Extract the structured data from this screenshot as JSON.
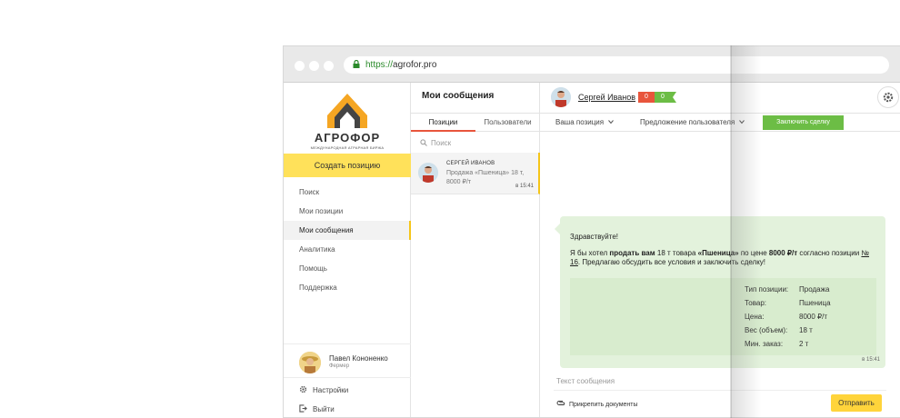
{
  "browser": {
    "url_protocol": "https://",
    "url_host": "agrofor.pro"
  },
  "sidebar": {
    "logo_name": "АГРОФОР",
    "logo_sub": "МЕЖДУНАРОДНАЯ АГРАРНАЯ БИРЖА",
    "create_button": "Создать позицию",
    "nav": [
      {
        "label": "Поиск"
      },
      {
        "label": "Мои позиции"
      },
      {
        "label": "Мои сообщения"
      },
      {
        "label": "Аналитика"
      },
      {
        "label": "Помощь"
      },
      {
        "label": "Поддержка"
      }
    ],
    "active_index": 2,
    "user": {
      "name": "Павел Кононенко",
      "role": "Фермер"
    },
    "settings_label": "Настройки",
    "logout_label": "Выйти"
  },
  "messages": {
    "title": "Мои сообщения",
    "tabs": [
      {
        "label": "Позиции"
      },
      {
        "label": "Пользователи"
      }
    ],
    "search_placeholder": "Поиск",
    "conversations": [
      {
        "name": "СЕРГЕЙ ИВАНОВ",
        "preview": "Продажа «Пшеница» 18 т, 8000 ₽/т",
        "time": "в 15:41"
      }
    ]
  },
  "chat": {
    "user_name": "Сергей Иванов",
    "score_negative": "0",
    "score_positive": "0",
    "dropdown_position": "Ваша позиция",
    "dropdown_offer": "Предложение пользователя",
    "deal_button": "Заключить сделку",
    "message": {
      "greeting": "Здравствуйте!",
      "text_1": "Я бы хотел ",
      "text_bold_1": "продать вам",
      "text_2": " 18 т товара ",
      "text_bold_2": "«Пшеница»",
      "text_3": " по цене ",
      "text_bold_3": "8000 ₽/т",
      "text_4": " согласно позиции ",
      "link": "№ 16",
      "text_5": ". Предлагаю обсудить все условия и заключить сделку!",
      "details": [
        {
          "key": "Тип позиции:",
          "value": "Продажа"
        },
        {
          "key": "Товар:",
          "value": "Пшеница"
        },
        {
          "key": "Цена:",
          "value": "8000 ₽/т"
        },
        {
          "key": "Вес (объем):",
          "value": "18 т"
        },
        {
          "key": "Мин. заказ:",
          "value": "2 т"
        }
      ],
      "time": "в 15:41"
    },
    "composer_placeholder": "Текст сообщения",
    "attach_label": "Прикрепить документы",
    "send_button": "Отправить"
  },
  "colors": {
    "accent_yellow": "#ffe15a",
    "accent_green": "#6cbd45",
    "accent_red": "#e8553c",
    "bubble_bg": "#e3f2dc"
  }
}
